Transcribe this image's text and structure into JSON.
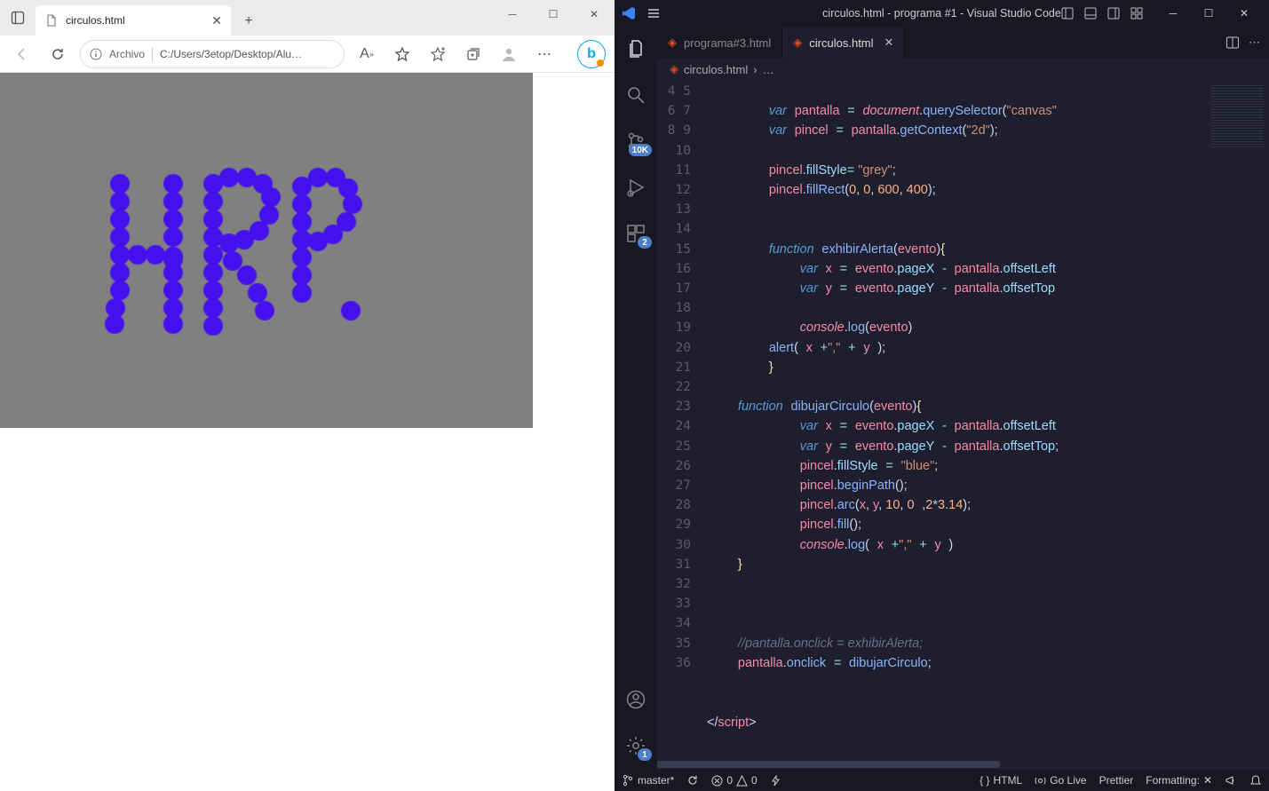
{
  "edge": {
    "tab_title": "circulos.html",
    "address_label": "Archivo",
    "address_url": "C:/Users/3etop/Desktop/Alu…",
    "canvas_letters": "HRP."
  },
  "vscode": {
    "title": "circulos.html - programa #1 - Visual Studio Code",
    "tabs": [
      {
        "label": "programa#3.html",
        "active": false
      },
      {
        "label": "circulos.html",
        "active": true
      }
    ],
    "breadcrumb_file": "circulos.html",
    "breadcrumb_more": "…",
    "source_control_badge": "10K",
    "extensions_badge": "2",
    "settings_badge": "1",
    "status": {
      "branch": "master*",
      "errors": "0",
      "warnings": "0",
      "lang": "HTML",
      "golive": "Go Live",
      "prettier": "Prettier",
      "formatting": "Formatting:"
    },
    "line_start": 4,
    "line_end": 36,
    "code_lines": [
      "",
      "        <span class='kw'>var</span> <span class='vr2'>pantalla</span> <span class='op'>=</span> <span class='cns'>document</span><span class='pn'>.</span><span class='fn2'>querySelector</span><span class='pn'>(</span><span class='str'>\"canvas\"</span>",
      "        <span class='kw'>var</span> <span class='vr2'>pincel</span> <span class='op'>=</span> <span class='vr2'>pantalla</span><span class='pn'>.</span><span class='fn2'>getContext</span><span class='pn'>(</span><span class='str'>\"2d\"</span><span class='pn'>);</span>",
      "",
      "        <span class='vr2'>pincel</span><span class='pn'>.</span><span class='vr'>fillStyle</span><span class='op'>= </span><span class='str'>\"grey\"</span><span class='pn'>;</span>",
      "        <span class='vr2'>pincel</span><span class='pn'>.</span><span class='fn2'>fillRect</span><span class='pn'>(</span><span class='num'>0</span><span class='pn'>, </span><span class='num'>0</span><span class='pn'>, </span><span class='num'>600</span><span class='pn'>, </span><span class='num'>400</span><span class='pn'>);</span>",
      "",
      "",
      "        <span class='kw'>function</span> <span class='fn2'>exhibirAlerta</span><span class='pn'>(</span><span class='vr2'>evento</span><span class='pn'>)</span><span class='pn2'>{</span>",
      "            <span class='kw'>var</span> <span class='vr2'>x</span> <span class='op'>=</span> <span class='vr2'>evento</span><span class='pn'>.</span><span class='vr'>pageX</span> <span class='op'>-</span> <span class='vr2'>pantalla</span><span class='pn'>.</span><span class='vr'>offsetLeft</span>",
      "            <span class='kw'>var</span> <span class='vr2'>y</span> <span class='op'>=</span> <span class='vr2'>evento</span><span class='pn'>.</span><span class='vr'>pageY</span> <span class='op'>-</span> <span class='vr2'>pantalla</span><span class='pn'>.</span><span class='vr'>offsetTop</span>",
      "",
      "            <span class='cns'>console</span><span class='pn'>.</span><span class='fn2'>log</span><span class='pn'>(</span><span class='vr2'>evento</span><span class='pn'>)</span>",
      "        <span class='fn2'>alert</span><span class='pn'>(</span> <span class='vr2'>x</span> <span class='op'>+</span><span class='str'>\",\"</span> <span class='op'>+</span> <span class='vr2'>y</span> <span class='pn'>);</span>",
      "        <span class='pn2'>}</span>",
      "",
      "    <span class='kw'>function</span> <span class='fn2'>dibujarCirculo</span><span class='pn'>(</span><span class='vr2'>evento</span><span class='pn'>)</span><span class='pn2'>{</span>",
      "            <span class='kw'>var</span> <span class='vr2'>x</span> <span class='op'>=</span> <span class='vr2'>evento</span><span class='pn'>.</span><span class='vr'>pageX</span> <span class='op'>-</span> <span class='vr2'>pantalla</span><span class='pn'>.</span><span class='vr'>offsetLeft</span>",
      "            <span class='kw'>var</span> <span class='vr2'>y</span> <span class='op'>=</span> <span class='vr2'>evento</span><span class='pn'>.</span><span class='vr'>pageY</span> <span class='op'>-</span> <span class='vr2'>pantalla</span><span class='pn'>.</span><span class='vr'>offsetTop</span><span class='pn'>;</span>",
      "            <span class='vr2'>pincel</span><span class='pn'>.</span><span class='vr'>fillStyle</span> <span class='op'>=</span> <span class='str'>\"blue\"</span><span class='pn'>;</span>",
      "            <span class='vr2'>pincel</span><span class='pn'>.</span><span class='fn2'>beginPath</span><span class='pn'>();</span>",
      "            <span class='vr2'>pincel</span><span class='pn'>.</span><span class='fn2'>arc</span><span class='pn'>(</span><span class='vr2'>x</span><span class='pn'>, </span><span class='vr2'>y</span><span class='pn'>, </span><span class='num'>10</span><span class='pn'>, </span><span class='num'>0</span> <span class='pn'>,</span><span class='num'>2</span><span class='op'>*</span><span class='num'>3.14</span><span class='pn'>);</span>",
      "            <span class='vr2'>pincel</span><span class='pn'>.</span><span class='fn2'>fill</span><span class='pn'>();</span>",
      "            <span class='cns'>console</span><span class='pn'>.</span><span class='fn2'>log</span><span class='pn'>(</span> <span class='vr2'>x</span> <span class='op'>+</span><span class='str'>\",\"</span> <span class='op'>+</span> <span class='vr2'>y</span> <span class='pn'>)</span>",
      "    <span class='pn2'>}</span>",
      "",
      "",
      "",
      "    <span class='cm'>//pantalla.onclick = exhibirAlerta;</span>",
      "    <span class='vr2'>pantalla</span><span class='pn'>.</span><span class='fn2'>onclick</span> <span class='op'>=</span> <span class='fn2'>dibujarCirculo</span><span class='pn'>;</span>",
      "",
      "",
      "<span class='pn'>&lt;/</span><span class='tag'>script</span><span class='pn'>&gt;</span>"
    ]
  }
}
